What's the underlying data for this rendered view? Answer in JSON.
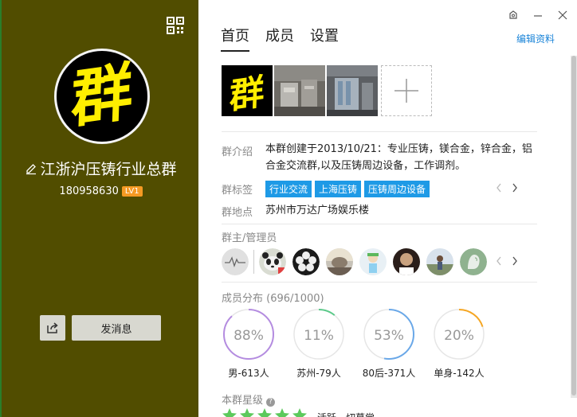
{
  "group": {
    "avatar_char": "群",
    "name": "江浙沪压铸行业总群",
    "id": "180958630",
    "level": "LV1"
  },
  "left_actions": {
    "send_label": "发消息"
  },
  "tabs": [
    {
      "label": "首页",
      "active": true
    },
    {
      "label": "成员",
      "active": false
    },
    {
      "label": "设置",
      "active": false
    }
  ],
  "edit_label": "编辑资料",
  "photos": {
    "first_char": "群"
  },
  "intro": {
    "label": "群介绍",
    "text": "本群创建于2013/10/21：专业压铸，镁合金，锌合金，铝合金交流群,以及压铸周边设备，工作调剂。"
  },
  "tags": {
    "label": "群标签",
    "items": [
      "行业交流",
      "上海压铸",
      "压铸周边设备"
    ]
  },
  "location": {
    "label": "群地点",
    "text": "苏州市万达广场娱乐楼"
  },
  "admins": {
    "label": "群主/管理员"
  },
  "distribution": {
    "label": "成员分布",
    "count": "(696/1000)",
    "items": [
      {
        "percent": "88%",
        "value": 88,
        "label": "男-613人",
        "color": "#b48ce0"
      },
      {
        "percent": "11%",
        "value": 11,
        "label": "苏州-79人",
        "color": "#5cc98a"
      },
      {
        "percent": "53%",
        "value": 53,
        "label": "80后-371人",
        "color": "#6aa8e8"
      },
      {
        "percent": "20%",
        "value": 20,
        "label": "单身-142人",
        "color": "#f5a623"
      }
    ]
  },
  "rating": {
    "label": "本群星级",
    "text": "活跃，切莫尝",
    "stars": 5
  },
  "colors": {
    "left_bg": "#514d00",
    "accent": "#1e9ae6",
    "link": "#1a84d8",
    "level_badge": "#f59a23"
  }
}
